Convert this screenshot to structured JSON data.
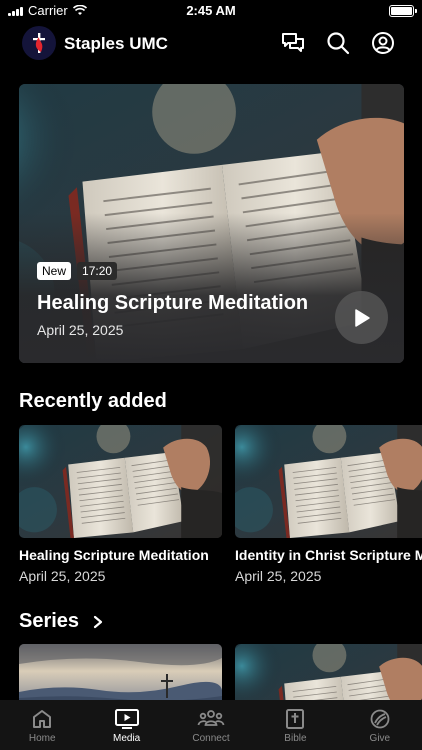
{
  "status_bar": {
    "carrier": "Carrier",
    "time": "2:45 AM"
  },
  "header": {
    "title": "Staples UMC",
    "icons": [
      "chat-icon",
      "search-icon",
      "account-icon"
    ]
  },
  "hero": {
    "badge_new": "New",
    "duration": "17:20",
    "title": "Healing Scripture Meditation",
    "date": "April 25, 2025"
  },
  "recent": {
    "heading": "Recently added",
    "items": [
      {
        "title": "Healing Scripture Meditation",
        "date": "April 25, 2025"
      },
      {
        "title": "Identity in Christ Scripture Meditation",
        "date": "April 25, 2025"
      }
    ]
  },
  "series": {
    "heading": "Series",
    "chevron": "chevron-right-icon"
  },
  "tabs": [
    {
      "label": "Home",
      "icon": "home-icon",
      "active": false
    },
    {
      "label": "Media",
      "icon": "tv-play-icon",
      "active": true
    },
    {
      "label": "Connect",
      "icon": "people-icon",
      "active": false
    },
    {
      "label": "Bible",
      "icon": "bible-icon",
      "active": false
    },
    {
      "label": "Give",
      "icon": "give-icon",
      "active": false
    }
  ],
  "colors": {
    "logo_flame": "#e3262f",
    "logo_bg": "#14143a",
    "tabbar_bg": "#141414"
  }
}
